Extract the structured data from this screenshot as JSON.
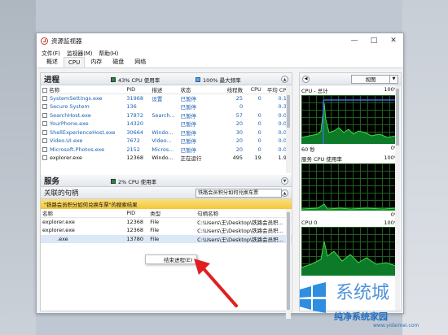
{
  "window": {
    "title": "资源监视器",
    "menu": [
      "文件(F)",
      "监视器(M)",
      "帮助(H)"
    ],
    "tabs": [
      "概述",
      "CPU",
      "内存",
      "磁盘",
      "网络"
    ],
    "active_tab": "CPU"
  },
  "processes": {
    "title": "进程",
    "cpu_usage": "43% CPU 使用率",
    "max_freq": "100% 最大频率",
    "columns": [
      "名称",
      "PID",
      "描述",
      "状态",
      "线程数",
      "CPU",
      "平均 CPU"
    ],
    "rows": [
      [
        "SystemSettings.exe",
        "31968",
        "设置",
        "已暂停",
        "25",
        "0",
        "0.16"
      ],
      [
        "Secure System",
        "136",
        "",
        "已暂停",
        "0",
        "",
        "0.35"
      ],
      [
        "SearchHost.exe",
        "17872",
        "Search...",
        "已暂停",
        "57",
        "0",
        "0.00"
      ],
      [
        "YourPhone.exe",
        "14320",
        "",
        "已暂停",
        "20",
        "0",
        "0.00"
      ],
      [
        "ShellExperienceHost.exe",
        "30664",
        "Windo...",
        "已暂停",
        "30",
        "0",
        "0.00"
      ],
      [
        "Video.UI.exe",
        "7672",
        "Video...",
        "已暂停",
        "20",
        "0",
        "0.00"
      ],
      [
        "Microsoft.Photos.exe",
        "2152",
        "Micros...",
        "已暂停",
        "20",
        "0",
        "0.00"
      ],
      [
        "explorer.exe",
        "12368",
        "Windo...",
        "正在运行",
        "495",
        "19",
        "1.99"
      ]
    ]
  },
  "services": {
    "title": "服务",
    "cpu_usage": "2% CPU 使用率"
  },
  "handles": {
    "title": "关联的句柄",
    "search_value": "铁路会员积分如何兑换车票",
    "banner": "\"铁路会员积分如何兑换车票\"的搜索结果",
    "columns": [
      "名称",
      "PID",
      "类型",
      "句柄名称"
    ],
    "rows": [
      [
        "explorer.exe",
        "12368",
        "File",
        "C:\\Users\\王\\Desktop\\铁路会员积..."
      ],
      [
        "explorer.exe",
        "12368",
        "File",
        "C:\\Users\\王\\Desktop\\铁路会员积..."
      ],
      [
        ".exe",
        "13780",
        "File",
        "C:\\Users\\王\\Desktop\\铁路会员积..."
      ]
    ],
    "context_menu": "结束进程(E)"
  },
  "right_panel": {
    "view_label": "视图",
    "graphs": [
      {
        "label": "CPU - 总计",
        "max": "100%",
        "bottom_left": "60 秒",
        "bottom_right": "0%"
      },
      {
        "label": "服务 CPU 使用率",
        "max": "100%",
        "bottom_left": "",
        "bottom_right": "0%"
      },
      {
        "label": "CPU 0",
        "max": "100%",
        "bottom_left": "",
        "bottom_right": ""
      }
    ]
  },
  "watermark": {
    "brand": "系统城",
    "site_name": "纯净系统家园",
    "url": "www.yidaimei.com"
  },
  "colors": {
    "graph_line": "#3ee03e",
    "graph_fill": "#0c7a28",
    "cpu_blue": "#3a6fe0",
    "banner": "#f3c73a",
    "process_link": "#1a5fb4"
  }
}
